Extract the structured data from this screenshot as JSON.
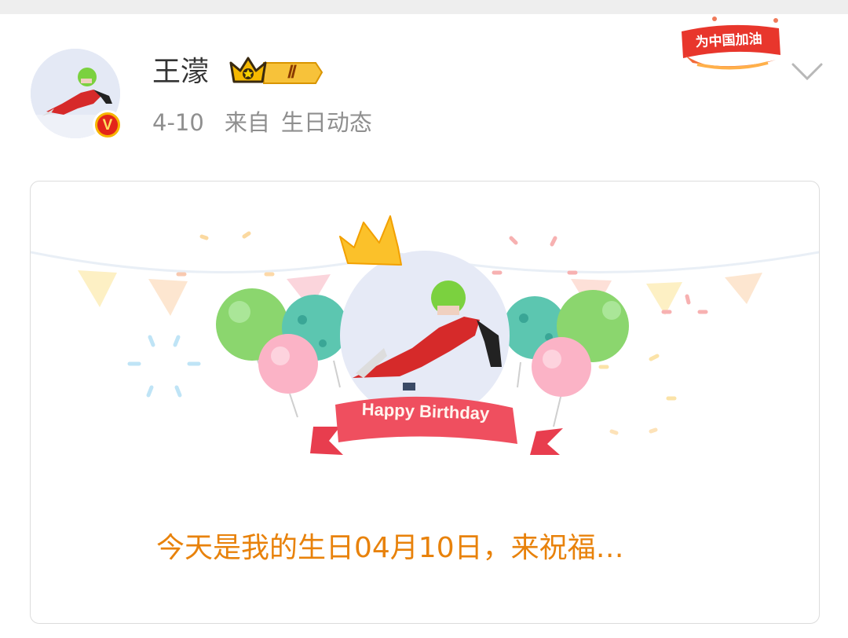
{
  "post": {
    "username": "王濛",
    "level": "Ⅱ",
    "date": "4-10",
    "source_prefix": "来自",
    "source": "生日动态",
    "cheer_badge": "为中国加油"
  },
  "card": {
    "banner_text": "Happy Birthday",
    "caption": "今天是我的生日04月10日，来祝福…"
  },
  "colors": {
    "caption": "#e8820b",
    "ribbon": "#ef4f5f",
    "verified": "#f7b500"
  },
  "icons": {
    "verified": "verified-v-icon",
    "crown": "crown-icon",
    "chevron": "chevron-down-icon"
  }
}
